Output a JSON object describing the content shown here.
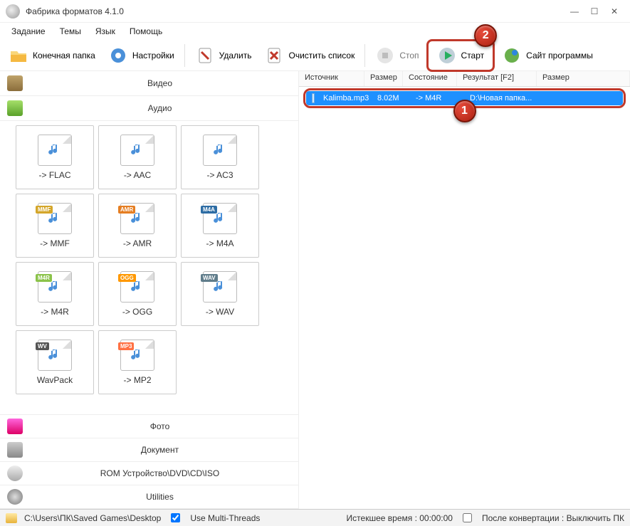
{
  "window": {
    "title": "Фабрика форматов 4.1.0"
  },
  "menu": {
    "task": "Задание",
    "themes": "Темы",
    "language": "Язык",
    "help": "Помощь"
  },
  "toolbar": {
    "output_folder": "Конечная папка",
    "settings": "Настройки",
    "delete": "Удалить",
    "clear": "Очистить список",
    "stop": "Стоп",
    "start": "Старт",
    "site": "Сайт программы"
  },
  "categories": {
    "video": "Видео",
    "audio": "Аудио",
    "photo": "Фото",
    "document": "Документ",
    "rom": "ROM Устройство\\DVD\\CD\\ISO",
    "utilities": "Utilities"
  },
  "formats": [
    {
      "label": "-> FLAC",
      "badge": "",
      "badge_cls": ""
    },
    {
      "label": "-> AAC",
      "badge": "",
      "badge_cls": ""
    },
    {
      "label": "-> AC3",
      "badge": "",
      "badge_cls": ""
    },
    {
      "label": "-> MMF",
      "badge": "MMF",
      "badge_cls": "badge-mmf"
    },
    {
      "label": "-> AMR",
      "badge": "AMR",
      "badge_cls": "badge-amr"
    },
    {
      "label": "-> M4A",
      "badge": "M4A",
      "badge_cls": "badge-m4a"
    },
    {
      "label": "-> M4R",
      "badge": "M4R",
      "badge_cls": "badge-m4r"
    },
    {
      "label": "-> OGG",
      "badge": "OGG",
      "badge_cls": "badge-ogg"
    },
    {
      "label": "-> WAV",
      "badge": "WAV",
      "badge_cls": "badge-wav"
    },
    {
      "label": "WavPack",
      "badge": "WV",
      "badge_cls": "badge-wv"
    },
    {
      "label": "-> MP2",
      "badge": "MP3",
      "badge_cls": "badge-mp3"
    }
  ],
  "table": {
    "headers": {
      "source": "Источник",
      "size": "Размер",
      "state": "Состояние",
      "result": "Результат [F2]",
      "size2": "Размер"
    },
    "row": {
      "source": "Kalimba.mp3",
      "size": "8.02M",
      "state": "-> M4R",
      "result": "D:\\Новая папка..."
    }
  },
  "status": {
    "path": "C:\\Users\\ПК\\Saved Games\\Desktop",
    "multithreads": "Use Multi-Threads",
    "elapsed": "Истекшее время : 00:00:00",
    "after": "После конвертации : Выключить ПК"
  },
  "step1": "1",
  "step2": "2"
}
